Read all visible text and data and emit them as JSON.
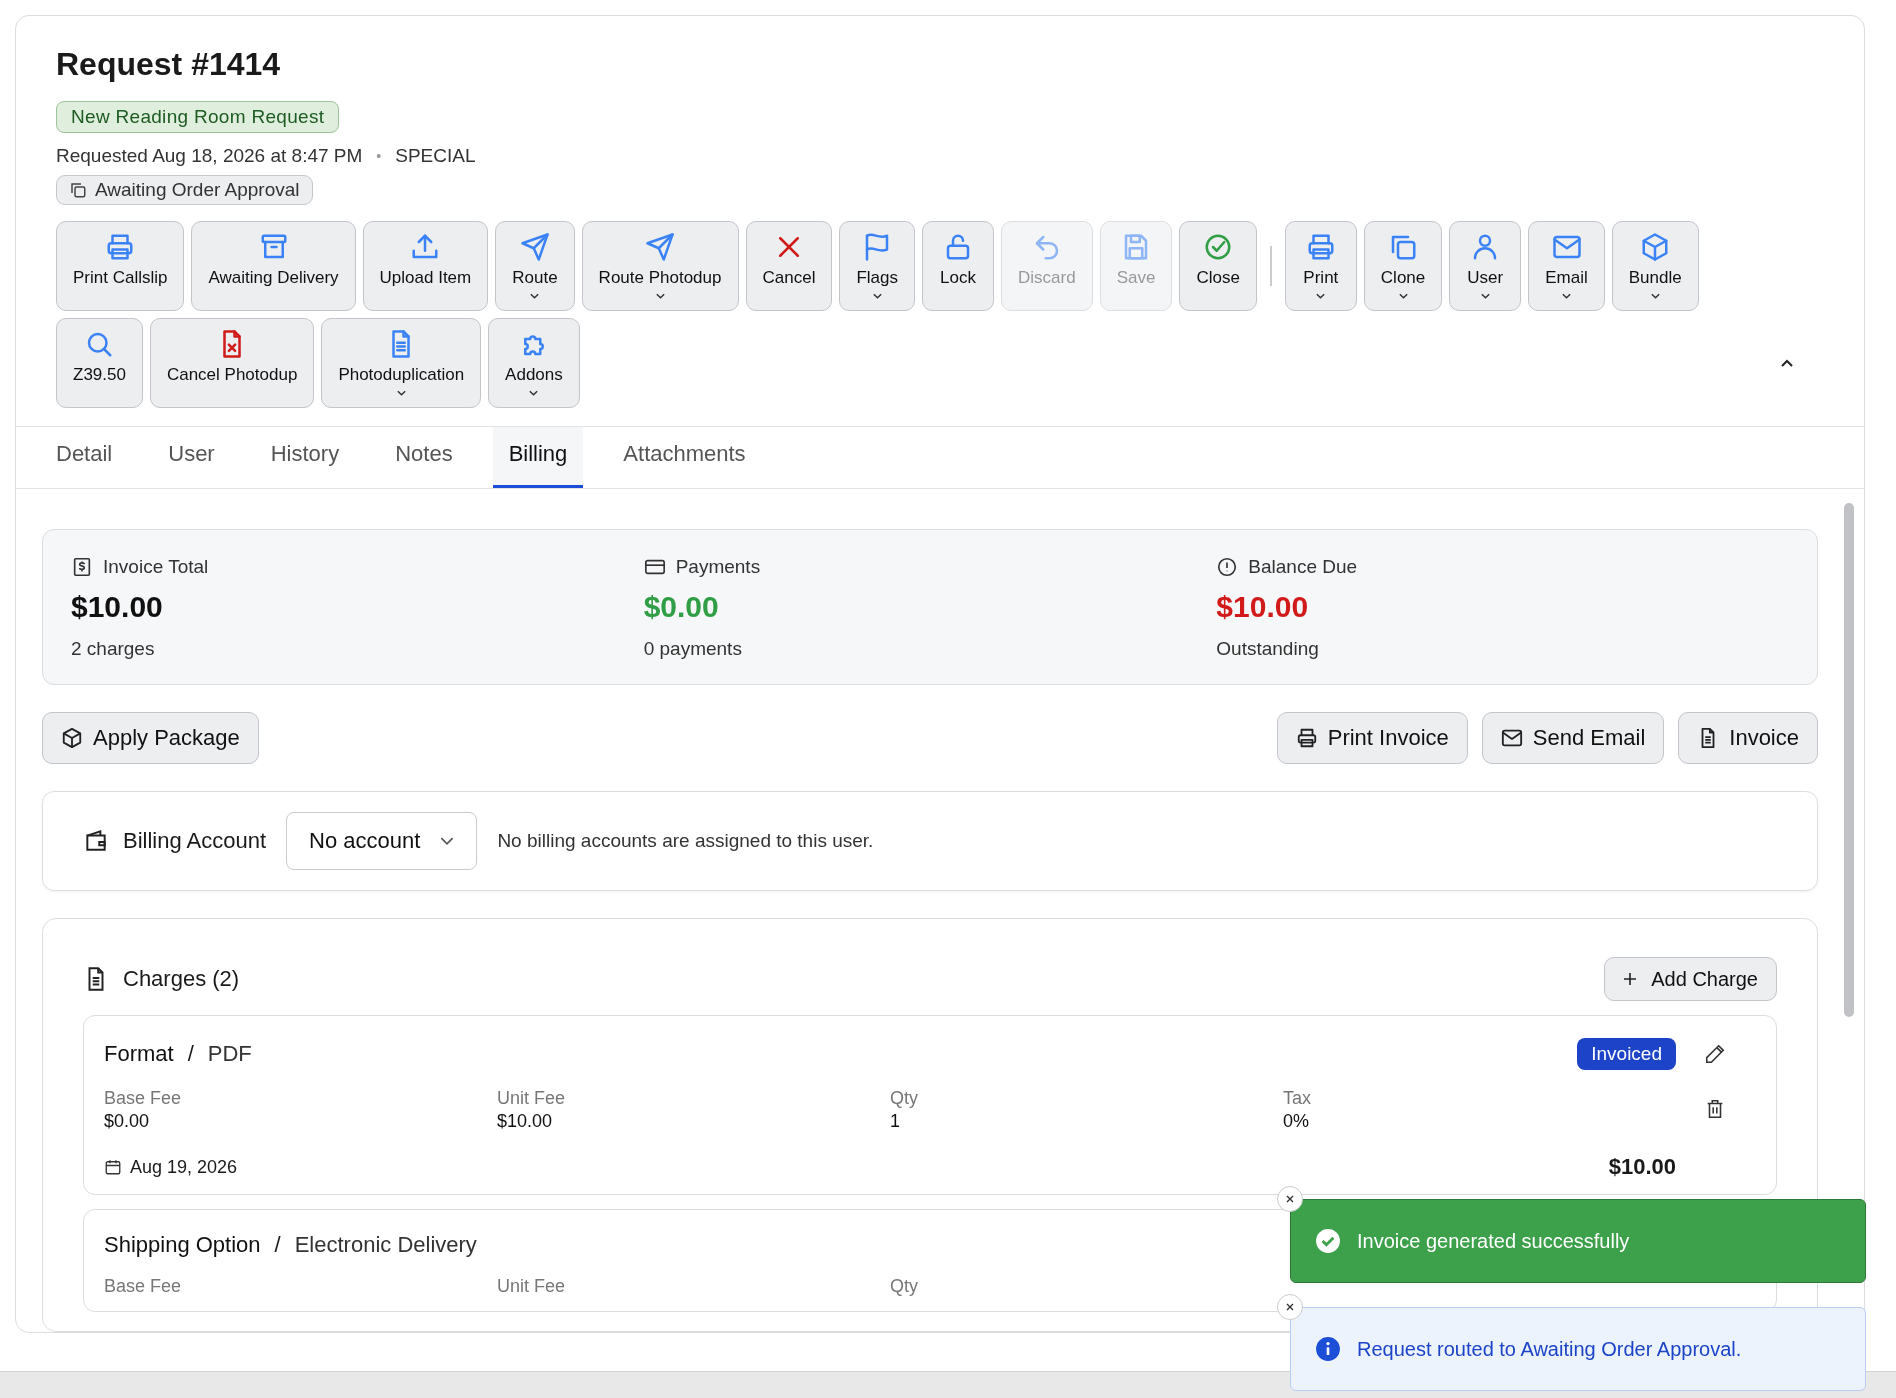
{
  "request": {
    "title": "Request #1414",
    "type_badge": "New Reading Room Request",
    "requested": "Requested Aug 18, 2026 at 8:47 PM",
    "separator": "•",
    "category": "SPECIAL",
    "status": "Awaiting Order Approval"
  },
  "toolbar": [
    [
      [
        {
          "label": "Print Callslip",
          "disabled": false,
          "dropdown": false
        },
        {
          "label": "Awaiting Delivery",
          "disabled": false,
          "dropdown": false
        },
        {
          "label": "Upload Item",
          "disabled": false,
          "dropdown": false
        },
        {
          "label": "Route",
          "disabled": false,
          "dropdown": true
        },
        {
          "label": "Route Photodup",
          "disabled": false,
          "dropdown": true
        },
        {
          "label": "Cancel",
          "disabled": false,
          "dropdown": false
        },
        {
          "label": "Flags",
          "disabled": false,
          "dropdown": true
        },
        {
          "label": "Lock",
          "disabled": false,
          "dropdown": false
        },
        {
          "label": "Discard",
          "disabled": true,
          "dropdown": false
        },
        {
          "label": "Save",
          "disabled": true,
          "dropdown": false
        },
        {
          "label": "Close",
          "disabled": false,
          "dropdown": false
        }
      ],
      [
        {
          "label": "Print",
          "disabled": false,
          "dropdown": true
        },
        {
          "label": "Clone",
          "disabled": false,
          "dropdown": true
        },
        {
          "label": "User",
          "disabled": false,
          "dropdown": true
        },
        {
          "label": "Email",
          "disabled": false,
          "dropdown": true
        },
        {
          "label": "Bundle",
          "disabled": false,
          "dropdown": true
        }
      ]
    ],
    [
      [
        {
          "label": "Z39.50",
          "disabled": false,
          "dropdown": false
        },
        {
          "label": "Cancel Photodup",
          "disabled": false,
          "dropdown": false
        },
        {
          "label": "Photoduplication",
          "disabled": false,
          "dropdown": true
        },
        {
          "label": "Addons",
          "disabled": false,
          "dropdown": true
        }
      ]
    ]
  ],
  "tabs": [
    {
      "label": "Detail",
      "selected": false
    },
    {
      "label": "User",
      "selected": false
    },
    {
      "label": "History",
      "selected": false
    },
    {
      "label": "Notes",
      "selected": false
    },
    {
      "label": "Billing",
      "selected": true
    },
    {
      "label": "Attachments",
      "selected": false
    }
  ],
  "summary": [
    {
      "label": "Invoice Total",
      "amount": "$10.00",
      "color": "#111111",
      "sub": "2 charges"
    },
    {
      "label": "Payments",
      "amount": "$0.00",
      "color": "#2f9e44",
      "sub": "0 payments"
    },
    {
      "label": "Balance Due",
      "amount": "$10.00",
      "color": "#d11a1a",
      "sub": "Outstanding"
    }
  ],
  "actions_left": [
    "Apply Package"
  ],
  "actions_right": [
    "Print Invoice",
    "Send Email",
    "Invoice"
  ],
  "billing_account": {
    "label": "Billing Account",
    "value": "No account",
    "note": "No billing accounts are assigned to this user."
  },
  "charges": {
    "title": "Charges (2)",
    "add_button": "Add Charge",
    "items": [
      {
        "type": "Format",
        "separator": "/",
        "value": "PDF",
        "status": "Invoiced",
        "fields": [
          {
            "label": "Base Fee",
            "value": "$0.00"
          },
          {
            "label": "Unit Fee",
            "value": "$10.00"
          },
          {
            "label": "Qty",
            "value": "1"
          },
          {
            "label": "Tax",
            "value": "0%"
          }
        ],
        "date": "Aug 19, 2026",
        "total": "$10.00"
      },
      {
        "type": "Shipping Option",
        "separator": "/",
        "value": "Electronic Delivery",
        "fields": [
          {
            "label": "Base Fee"
          },
          {
            "label": "Unit Fee"
          },
          {
            "label": "Qty"
          }
        ]
      }
    ]
  },
  "toasts": [
    {
      "kind": "success",
      "message": "Invoice generated successfully"
    },
    {
      "kind": "info",
      "message": "Request routed to Awaiting Order Approval."
    }
  ]
}
